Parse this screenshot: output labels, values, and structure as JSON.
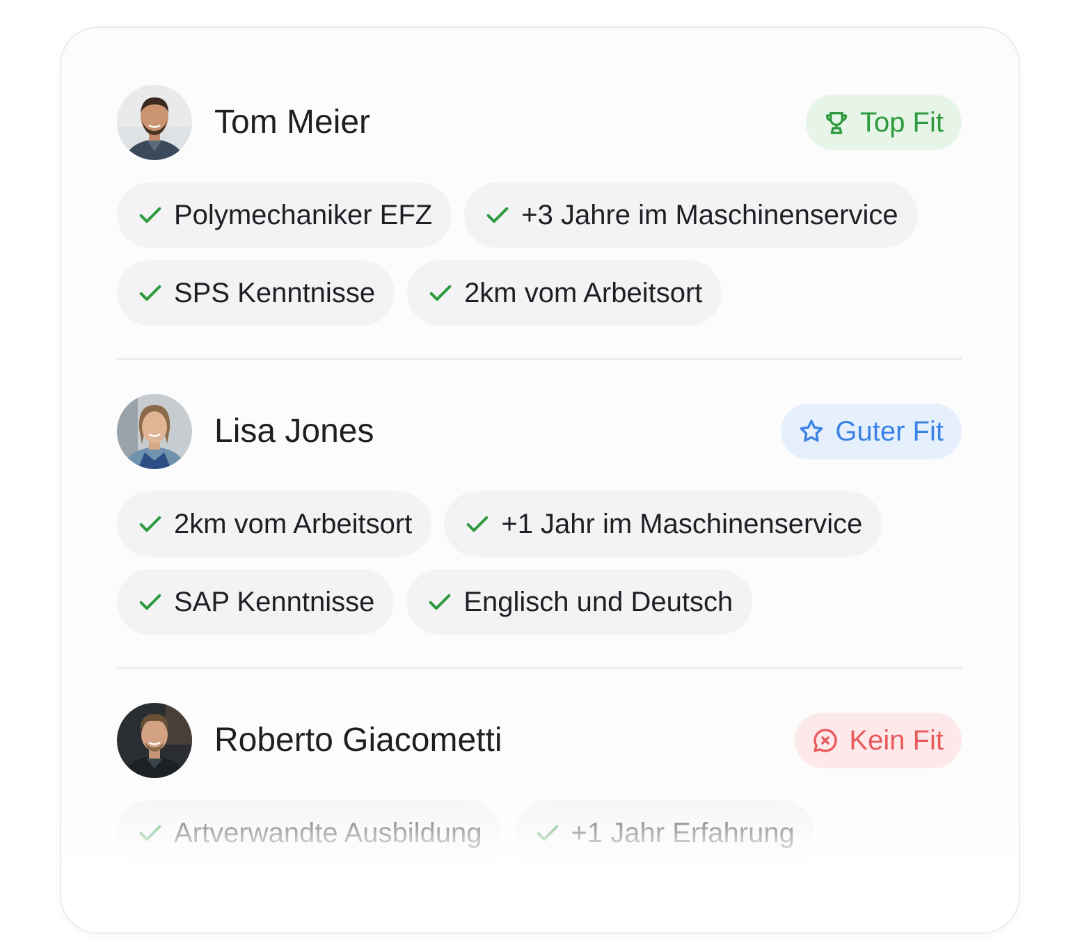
{
  "candidates": [
    {
      "name": "Tom Meier",
      "fit": {
        "label": "Top Fit",
        "icon": "trophy-icon",
        "color": "#2d9a3e"
      },
      "tags": [
        "Polymechaniker EFZ",
        "+3 Jahre im Maschinenservice",
        "SPS Kenntnisse",
        "2km vom Arbeitsort"
      ]
    },
    {
      "name": "Lisa Jones",
      "fit": {
        "label": "Guter Fit",
        "icon": "star-icon",
        "color": "#3a82e6"
      },
      "tags": [
        "2km vom Arbeitsort",
        "+1 Jahr im Maschinenservice",
        "SAP Kenntnisse",
        "Englisch und Deutsch"
      ]
    },
    {
      "name": "Roberto Giacometti",
      "fit": {
        "label": "Kein Fit",
        "icon": "x-circle-chat-icon",
        "color": "#e85a5c"
      },
      "tags": [
        "Artverwandte Ausbildung",
        "+1 Jahr Erfahrung"
      ]
    }
  ],
  "tag_icon": "check-icon",
  "check_color": "#2d9a3e"
}
